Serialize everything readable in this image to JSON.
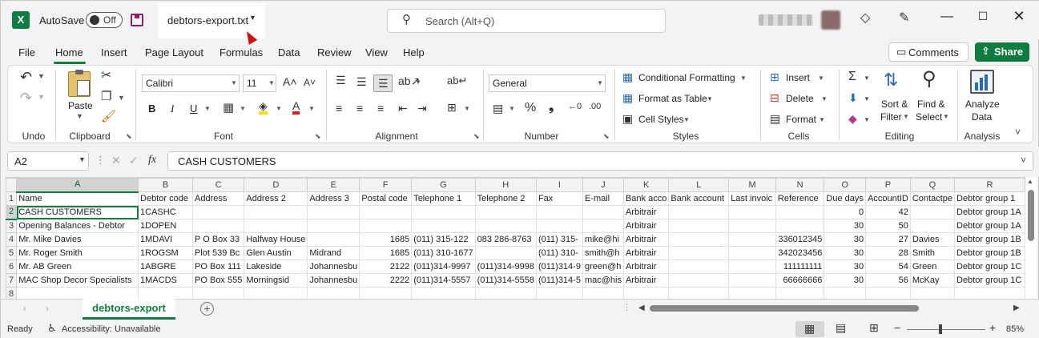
{
  "titlebar": {
    "app_letter": "X",
    "autosave_label": "AutoSave",
    "autosave_state": "Off",
    "file_name": "debtors-export.txt",
    "search_placeholder": "Search (Alt+Q)"
  },
  "menu": {
    "tabs": [
      "File",
      "Home",
      "Insert",
      "Page Layout",
      "Formulas",
      "Data",
      "Review",
      "View",
      "Help"
    ],
    "comments": "Comments",
    "share": "Share"
  },
  "ribbon": {
    "undo_label": "Undo",
    "clipboard": {
      "paste": "Paste",
      "label": "Clipboard"
    },
    "font": {
      "name": "Calibri",
      "size": "11",
      "label": "Font",
      "bold": "B",
      "italic": "I",
      "underline": "U"
    },
    "alignment": {
      "label": "Alignment"
    },
    "number": {
      "format": "General",
      "label": "Number"
    },
    "styles": {
      "conditional": "Conditional Formatting",
      "format_table": "Format as Table",
      "cell_styles": "Cell Styles",
      "label": "Styles"
    },
    "cells": {
      "insert": "Insert",
      "delete": "Delete",
      "format": "Format",
      "label": "Cells"
    },
    "editing": {
      "sort_filter_1": "Sort &",
      "sort_filter_2": "Filter",
      "find_select_1": "Find &",
      "find_select_2": "Select",
      "label": "Editing"
    },
    "analysis": {
      "analyze_1": "Analyze",
      "analyze_2": "Data",
      "label": "Analysis"
    }
  },
  "formula_bar": {
    "name_box": "A2",
    "fx": "fx",
    "value": "CASH CUSTOMERS"
  },
  "sheet": {
    "columns": [
      "A",
      "B",
      "C",
      "D",
      "E",
      "F",
      "G",
      "H",
      "I",
      "J",
      "K",
      "L",
      "M",
      "N",
      "O",
      "P",
      "Q",
      "R"
    ],
    "rows": [
      [
        "Name",
        "Debtor code",
        "Address",
        "Address 2",
        "Address 3",
        "Postal code",
        "Telephone 1",
        "Telephone 2",
        "Fax",
        "E-mail",
        "Bank acco",
        "Bank account",
        "Last invoic",
        "Reference",
        "Due days",
        "AccountID",
        "Contactpe",
        "Debtor group 1"
      ],
      [
        "CASH CUSTOMERS",
        "1CASHC",
        "",
        "",
        "",
        "",
        "",
        "",
        "",
        "",
        "Arbitrair",
        "",
        "",
        "",
        "0",
        "42",
        "",
        "Debtor group 1A"
      ],
      [
        "Opening Balances - Debtor",
        "1DOPEN",
        "",
        "",
        "",
        "",
        "",
        "",
        "",
        "",
        "Arbitrair",
        "",
        "",
        "",
        "30",
        "50",
        "",
        "Debtor group 1A"
      ],
      [
        "Mr. Mike Davies",
        "1MDAVI",
        "P O Box 33",
        "Halfway House",
        "",
        "1685",
        "(011) 315-122",
        "083 286-8763",
        "(011) 315-",
        "mike@hi",
        "Arbitrair",
        "",
        "",
        "336012345",
        "30",
        "27",
        "Davies",
        "Debtor group 1B"
      ],
      [
        "Mr. Roger Smith",
        "1ROGSM",
        "Plot 539 Bc",
        "Glen Austin",
        "Midrand",
        "1685",
        "(011) 310-1677",
        "",
        "(011) 310-",
        "smith@h",
        "Arbitrair",
        "",
        "",
        "342023456",
        "30",
        "28",
        "Smith",
        "Debtor group 1B"
      ],
      [
        "Mr. AB Green",
        "1ABGRE",
        "PO Box 111",
        "Lakeside",
        "Johannesbu",
        "2122",
        "(011)314-9997",
        "(011)314-9998",
        "(011)314-9",
        "green@h",
        "Arbitrair",
        "",
        "",
        "111111111",
        "30",
        "54",
        "Green",
        "Debtor group 1C"
      ],
      [
        "MAC Shop Decor Specialists",
        "1MACDS",
        "PO Box 555",
        "Morningsid",
        "Johannesbu",
        "2222",
        "(011)314-5557",
        "(011)314-5558",
        "(011)314-5",
        "mac@his",
        "Arbitrair",
        "",
        "",
        "66666666",
        "30",
        "56",
        "McKay",
        "Debtor group 1C"
      ],
      [
        "",
        "",
        "",
        "",
        "",
        "",
        "",
        "",
        "",
        "",
        "",
        "",
        "",
        "",
        "",
        "",
        "",
        ""
      ]
    ],
    "tab_name": "debtors-export"
  },
  "status": {
    "ready": "Ready",
    "accessibility": "Accessibility: Unavailable",
    "zoom": "85%"
  }
}
